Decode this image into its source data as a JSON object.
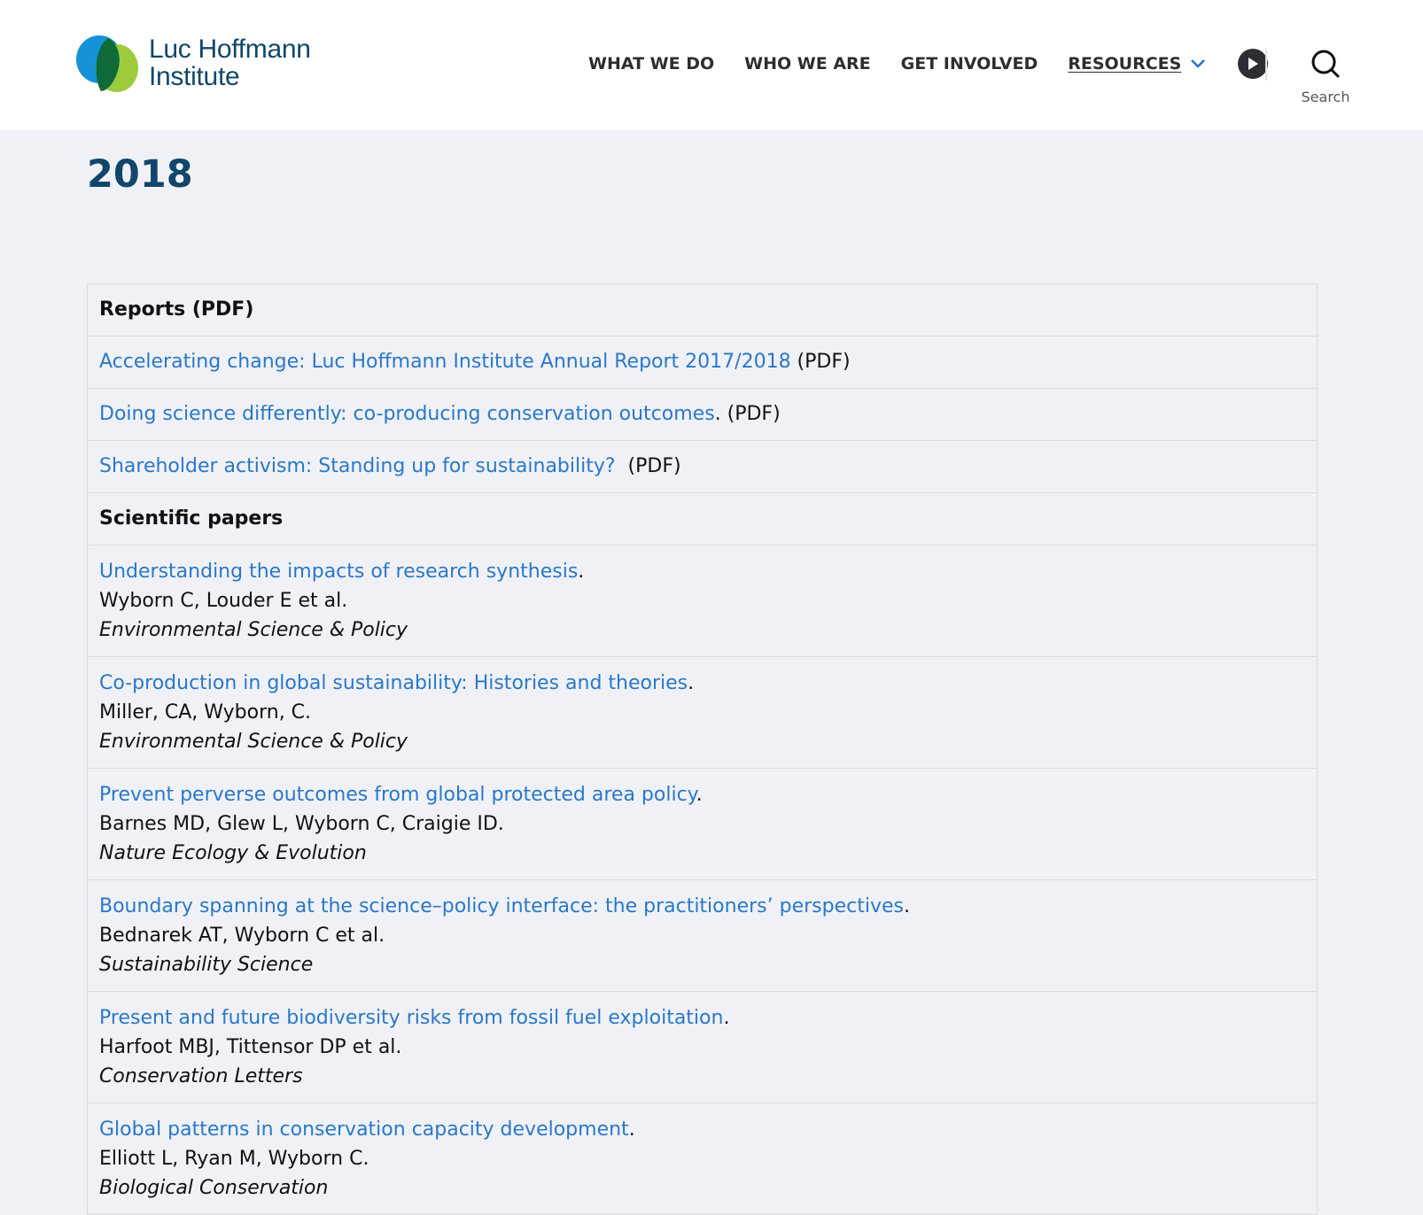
{
  "logo": {
    "line1": "Luc Hoffmann",
    "line2": "Institute"
  },
  "nav": {
    "items": [
      "WHAT WE DO",
      "WHO WE ARE",
      "GET INVOLVED"
    ],
    "active": "RESOURCES",
    "search_label": "Search"
  },
  "page": {
    "title": "2018"
  },
  "reports": {
    "heading": "Reports (PDF)",
    "items": [
      {
        "title": "Accelerating change: Luc Hoffmann Institute Annual Report 2017/2018",
        "suffix": " (PDF)"
      },
      {
        "title": "Doing science differently: co-producing conservation outcomes",
        "suffix": ". (PDF)"
      },
      {
        "title": "Shareholder activism: Standing up for sustainability?",
        "suffix": "  (PDF)"
      }
    ]
  },
  "papers": {
    "heading": "Scientific papers",
    "items": [
      {
        "title": "Understanding the impacts of research synthesis",
        "end": ".",
        "authors": "Wyborn C, Louder E et al.",
        "journal": "Environmental Science & Policy"
      },
      {
        "title": "Co-production in global sustainability: Histories and theories",
        "end": ".",
        "authors": "Miller, CA, Wyborn, C.",
        "journal": "Environmental Science & Policy"
      },
      {
        "title": "Prevent perverse outcomes from global protected area policy",
        "end": ".",
        "authors": "Barnes MD, Glew L, Wyborn C, Craigie ID.",
        "journal": "Nature Ecology & Evolution"
      },
      {
        "title": "Boundary spanning at the science–policy interface: the practitioners’ perspectives",
        "end": ".",
        "authors": "Bednarek AT, Wyborn C et al.",
        "journal": "Sustainability Science"
      },
      {
        "title": "Present and future biodiversity risks from fossil fuel exploitation",
        "end": ".",
        "authors": "Harfoot MBJ, Tittensor DP et al.",
        "journal": "Conservation Letters"
      },
      {
        "title": "Global patterns in conservation capacity development",
        "end": ".",
        "authors": "Elliott L, Ryan M, Wyborn C.",
        "journal": "Biological Conservation"
      }
    ]
  },
  "colors": {
    "link": "#2a78c8",
    "brand": "#10466b",
    "background": "#f0f1f6"
  }
}
